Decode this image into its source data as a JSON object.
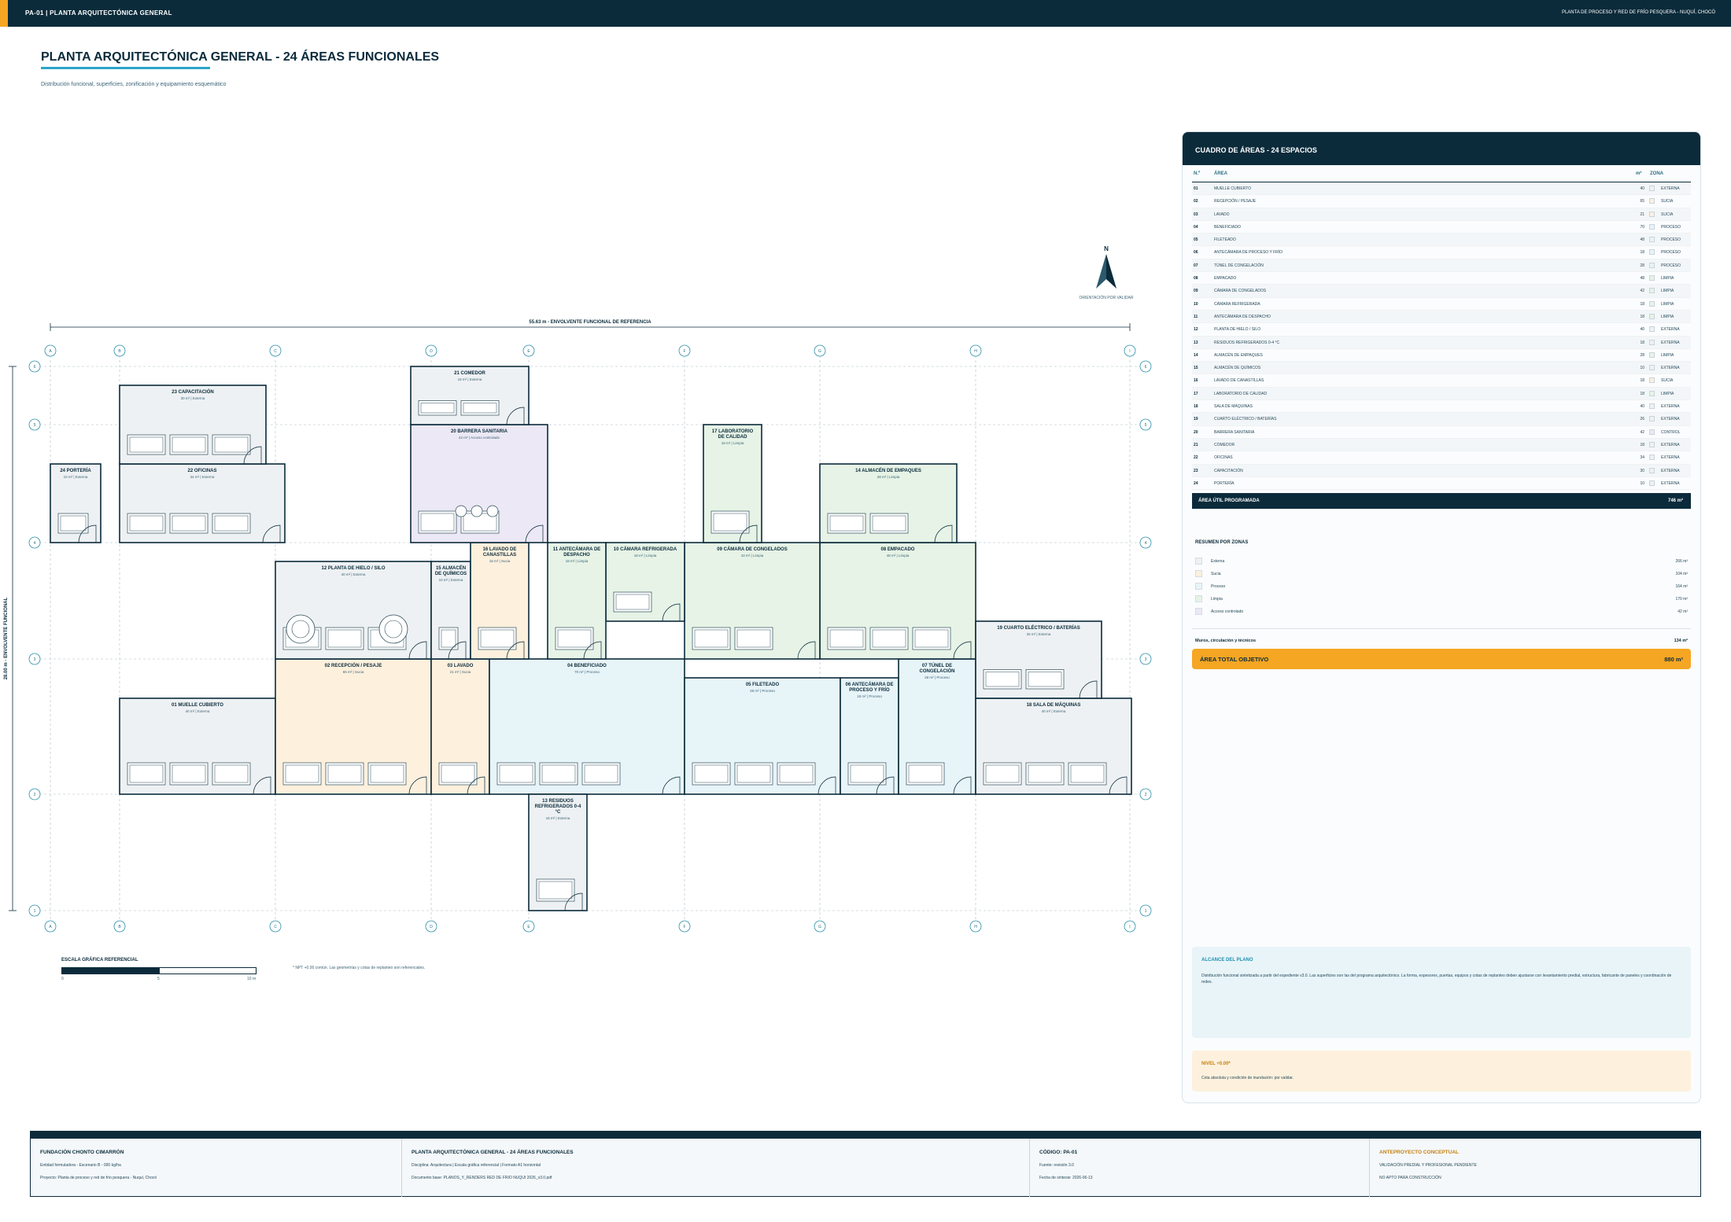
{
  "header": {
    "sheet": "PA-01  |  PLANTA ARQUITECTÓNICA GENERAL",
    "project": "PLANTA DE PROCESO Y RED DE FRÍO PESQUERA - NUQUÍ, CHOCÓ"
  },
  "page": {
    "title": "PLANTA ARQUITECTÓNICA GENERAL - 24 ÁREAS FUNCIONALES",
    "subtitle": "Distribución funcional, superficies, zonificación y equipamiento esquemático"
  },
  "plan": {
    "width_label": "55.63 m - ENVOLVENTE FUNCIONAL DE REFERENCIA",
    "height_label": "28.00 m - ENVOLVENTE FUNCIONAL",
    "axes_letters": [
      "A",
      "B",
      "C",
      "D",
      "E",
      "F",
      "G",
      "H",
      "I"
    ],
    "axes_numbers": [
      "6",
      "5",
      "4",
      "3",
      "2",
      "1"
    ],
    "zone_colors": {
      "Externa": "#eef1f3",
      "Sucia": "#fdf0dd",
      "Proceso": "#e7f4f8",
      "Limpia": "#e6f3e6",
      "Acceso controlado": "#ece8f5"
    },
    "rooms": [
      {
        "id": "01",
        "name": "01  MUELLE CUBIERTO",
        "meta": "40 m²  |  Externa",
        "zone": "Externa"
      },
      {
        "id": "02",
        "name": "02  RECEPCIÓN / PESAJE",
        "meta": "65 m²  |  Sucia",
        "zone": "Sucia"
      },
      {
        "id": "03",
        "name": "03  LAVADO",
        "meta": "21 m²  |  Sucia",
        "zone": "Sucia"
      },
      {
        "id": "04",
        "name": "04  BENEFICIADO",
        "meta": "70 m²  |  Proceso",
        "zone": "Proceso"
      },
      {
        "id": "05",
        "name": "05  FILETEADO",
        "meta": "48 m²  |  Proceso",
        "zone": "Proceso"
      },
      {
        "id": "06",
        "name": "06  ANTECÁMARA DE PROCESO Y FRÍO",
        "meta": "18 m²  |  Proceso",
        "zone": "Proceso"
      },
      {
        "id": "07",
        "name": "07  TÚNEL DE CONGELACIÓN",
        "meta": "28 m²  |  Proceso",
        "zone": "Proceso"
      },
      {
        "id": "08",
        "name": "08  EMPACADO",
        "meta": "48 m²  |  Limpia",
        "zone": "Limpia"
      },
      {
        "id": "09",
        "name": "09  CÁMARA DE CONGELADOS",
        "meta": "42 m²  |  Limpia",
        "zone": "Limpia"
      },
      {
        "id": "10",
        "name": "10  CÁMARA REFRIGERADA",
        "meta": "18 m²  |  Limpia",
        "zone": "Limpia"
      },
      {
        "id": "11",
        "name": "11  ANTECÁMARA DE DESPACHO",
        "meta": "18 m²  |  Limpia",
        "zone": "Limpia"
      },
      {
        "id": "12",
        "name": "12  PLANTA DE HIELO / SILO",
        "meta": "40 m²  |  Externa",
        "zone": "Externa"
      },
      {
        "id": "13",
        "name": "13  RESIDUOS REFRIGERADOS 0-4 °C",
        "meta": "18 m²  |  Externa",
        "zone": "Externa"
      },
      {
        "id": "14",
        "name": "14  ALMACÉN DE EMPAQUES",
        "meta": "28 m²  |  Limpia",
        "zone": "Limpia"
      },
      {
        "id": "15",
        "name": "15  ALMACÉN DE QUÍMICOS",
        "meta": "10 m²  |  Externa",
        "zone": "Externa"
      },
      {
        "id": "16",
        "name": "16  LAVADO DE CANASTILLAS",
        "meta": "18 m²  |  Sucia",
        "zone": "Sucia"
      },
      {
        "id": "17",
        "name": "17  LABORATORIO DE CALIDAD",
        "meta": "18 m²  |  Limpia",
        "zone": "Limpia"
      },
      {
        "id": "18",
        "name": "18  SALA DE MÁQUINAS",
        "meta": "40 m²  |  Externa",
        "zone": "Externa"
      },
      {
        "id": "19",
        "name": "19  CUARTO ELÉCTRICO / BATERÍAS",
        "meta": "26 m²  |  Externa",
        "zone": "Externa"
      },
      {
        "id": "20",
        "name": "20  BARRERA SANITARIA",
        "meta": "42 m²  |  Acceso controlado",
        "zone": "Acceso controlado"
      },
      {
        "id": "21",
        "name": "21  COMEDOR",
        "meta": "18 m²  |  Externa",
        "zone": "Externa"
      },
      {
        "id": "22",
        "name": "22  OFICINAS",
        "meta": "34 m²  |  Externa",
        "zone": "Externa"
      },
      {
        "id": "23",
        "name": "23  CAPACITACIÓN",
        "meta": "30 m²  |  Externa",
        "zone": "Externa"
      },
      {
        "id": "24",
        "name": "24  PORTERÍA",
        "meta": "10 m²  |  Externa",
        "zone": "Externa"
      }
    ]
  },
  "north": {
    "letter": "N",
    "caption": "ORIENTACIÓN POR VALIDAR"
  },
  "scale": {
    "caption": "ESCALA GRÁFICA REFERENCIAL",
    "ticks": [
      "0",
      "5",
      "10 m"
    ]
  },
  "npt_note": "* NPT +0.00 común. Las geometrías y cotas de replanteo son referenciales.",
  "table": {
    "title": "CUADRO DE ÁREAS - 24 ESPACIOS",
    "col_num": "N.º",
    "col_area": "ÁREA",
    "col_m2": "m²",
    "col_zone": "ZONA",
    "rows": [
      {
        "num": "01",
        "area": "MUELLE CUBIERTO",
        "m2": "40",
        "zone": "EXTERNA"
      },
      {
        "num": "02",
        "area": "RECEPCIÓN / PESAJE",
        "m2": "65",
        "zone": "SUCIA"
      },
      {
        "num": "03",
        "area": "LAVADO",
        "m2": "21",
        "zone": "SUCIA"
      },
      {
        "num": "04",
        "area": "BENEFICIADO",
        "m2": "70",
        "zone": "PROCESO"
      },
      {
        "num": "05",
        "area": "FILETEADO",
        "m2": "48",
        "zone": "PROCESO"
      },
      {
        "num": "06",
        "area": "ANTECÁMARA DE PROCESO Y FRÍO",
        "m2": "18",
        "zone": "PROCESO"
      },
      {
        "num": "07",
        "area": "TÚNEL DE CONGELACIÓN",
        "m2": "28",
        "zone": "PROCESO"
      },
      {
        "num": "08",
        "area": "EMPACADO",
        "m2": "48",
        "zone": "LIMPIA"
      },
      {
        "num": "09",
        "area": "CÁMARA DE CONGELADOS",
        "m2": "42",
        "zone": "LIMPIA"
      },
      {
        "num": "10",
        "area": "CÁMARA REFRIGERADA",
        "m2": "18",
        "zone": "LIMPIA"
      },
      {
        "num": "11",
        "area": "ANTECÁMARA DE DESPACHO",
        "m2": "18",
        "zone": "LIMPIA"
      },
      {
        "num": "12",
        "area": "PLANTA DE HIELO / SILO",
        "m2": "40",
        "zone": "EXTERNA"
      },
      {
        "num": "13",
        "area": "RESIDUOS REFRIGERADOS 0-4 °C",
        "m2": "18",
        "zone": "EXTERNA"
      },
      {
        "num": "14",
        "area": "ALMACÉN DE EMPAQUES",
        "m2": "28",
        "zone": "LIMPIA"
      },
      {
        "num": "15",
        "area": "ALMACÉN DE QUÍMICOS",
        "m2": "10",
        "zone": "EXTERNA"
      },
      {
        "num": "16",
        "area": "LAVADO DE CANASTILLAS",
        "m2": "18",
        "zone": "SUCIA"
      },
      {
        "num": "17",
        "area": "LABORATORIO DE CALIDAD",
        "m2": "18",
        "zone": "LIMPIA"
      },
      {
        "num": "18",
        "area": "SALA DE MÁQUINAS",
        "m2": "40",
        "zone": "EXTERNA"
      },
      {
        "num": "19",
        "area": "CUARTO ELÉCTRICO / BATERÍAS",
        "m2": "26",
        "zone": "EXTERNA"
      },
      {
        "num": "20",
        "area": "BARRERA SANITARIA",
        "m2": "42",
        "zone": "CONTROL"
      },
      {
        "num": "21",
        "area": "COMEDOR",
        "m2": "18",
        "zone": "EXTERNA"
      },
      {
        "num": "22",
        "area": "OFICINAS",
        "m2": "34",
        "zone": "EXTERNA"
      },
      {
        "num": "23",
        "area": "CAPACITACIÓN",
        "m2": "30",
        "zone": "EXTERNA"
      },
      {
        "num": "24",
        "area": "PORTERÍA",
        "m2": "10",
        "zone": "EXTERNA"
      }
    ],
    "total_util_label": "ÁREA ÚTIL PROGRAMADA",
    "total_util_value": "746 m²"
  },
  "zones_summary": {
    "title": "RESUMEN POR ZONAS",
    "items": [
      {
        "label": "Externa",
        "value": "266 m²",
        "color": "#eef1f3"
      },
      {
        "label": "Sucia",
        "value": "104 m²",
        "color": "#fdf0dd"
      },
      {
        "label": "Proceso",
        "value": "164 m²",
        "color": "#e7f4f8"
      },
      {
        "label": "Limpia",
        "value": "170 m²",
        "color": "#e6f3e6"
      },
      {
        "label": "Acceso controlado",
        "value": "42 m²",
        "color": "#ece8f5"
      }
    ],
    "muros_label": "Muros, circulación y técnicos",
    "muros_value": "134 m²",
    "total_label": "ÁREA TOTAL OBJETIVO",
    "total_value": "880 m²"
  },
  "alcance": {
    "title": "ALCANCE DEL PLANO",
    "text": "Distribución funcional sintetizada a partir del expediente v3.0. Las superficies son las del programa arquitectónico. La forma, espesores, puertas, equipos y cotas de replanteo deben ajustarse con levantamiento predial, estructura, fabricante de paneles y coordinación de redes."
  },
  "nivel": {
    "title": "NIVEL +0.00*",
    "text": "Cota absoluta y condición de inundación: por validar."
  },
  "footer": {
    "org": "FUNDACIÓN CHONTO CIMARRÓN",
    "entity": "Entidad formuladora - Escenario B - 000 kg/ha",
    "project": "Proyecto: Planta de proceso y red de frío pesquera - Nuquí, Chocó",
    "title": "PLANTA ARQUITECTÓNICA GENERAL - 24 ÁREAS FUNCIONALES",
    "discipline": "Disciplina: Arquitectura | Escala gráfica referencial | Formato A1 horizontal",
    "doc": "Documento base: PLANOS_Y_RENDERS RED DE FRIO NUQUI 2026_v3.0.pdf",
    "code": "CÓDIGO: PA-01",
    "source": "Fuente: revisión 3.0",
    "date": "Fecha de síntesis: 2026-06-13",
    "status": "ANTEPROYECTO CONCEPTUAL",
    "val": "VALIDACIÓN PREDIAL Y PROFESIONAL PENDIENTE",
    "noapto": "NO APTO PARA CONSTRUCCIÓN"
  }
}
